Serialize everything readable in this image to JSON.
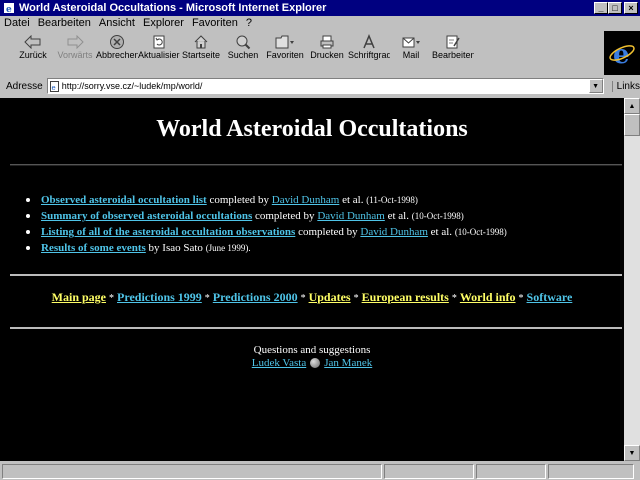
{
  "window": {
    "title": "World Asteroidal Occultations - Microsoft Internet Explorer",
    "minimize_glyph": "_",
    "maximize_glyph": "□",
    "close_glyph": "×"
  },
  "menu": [
    {
      "label": "Datei"
    },
    {
      "label": "Bearbeiten"
    },
    {
      "label": "Ansicht"
    },
    {
      "label": "Explorer"
    },
    {
      "label": "Favoriten"
    },
    {
      "label": "?"
    }
  ],
  "toolbar": {
    "back": "Zurück",
    "forward": "Vorwärts",
    "stop": "Abbrechen",
    "refresh": "Aktualisieren",
    "home": "Startseite",
    "search": "Suchen",
    "favorites": "Favoriten",
    "print": "Drucken",
    "font": "Schriftgrad",
    "mail": "Mail",
    "edit": "Bearbeiten"
  },
  "address": {
    "label": "Adresse",
    "url": "http://sorry.vse.cz/~ludek/mp/world/",
    "links_label": "Links"
  },
  "page": {
    "title": "World Asteroidal Occultations",
    "items": [
      {
        "link": "Observed asteroidal occultation list",
        "text": "completed by",
        "author": "David Dunham",
        "suffix": "et al.",
        "date": "(11-Oct-1998)"
      },
      {
        "link": "Summary of observed asteroidal occultations",
        "text": "completed by",
        "author": "David Dunham",
        "suffix": "et al.",
        "date": "(10-Oct-1998)"
      },
      {
        "link": "Listing of all of the asteroidal occultation observations",
        "text": "completed by",
        "author": "David Dunham",
        "suffix": "et al.",
        "date": "(10-Oct-1998)"
      },
      {
        "link": "Results of some events",
        "text": "by Isao Sato",
        "date": "(June 1999)."
      }
    ],
    "nav": {
      "main_page": "Main page",
      "predictions_1999": "Predictions 1999",
      "predictions_2000": "Predictions 2000",
      "updates": "Updates",
      "european_results": "European results",
      "world_info": "World info",
      "software": "Software",
      "separator": "*"
    },
    "footer": {
      "question": "Questions and suggestions",
      "name1": "Ludek Vasta",
      "name2": "Jan Manek"
    }
  },
  "colors": {
    "title_bar": "#000080",
    "chrome": "#c0c0c0",
    "page_bg": "#000000",
    "link_cyan": "#4fc4e8",
    "link_yellow": "#ffff66"
  }
}
